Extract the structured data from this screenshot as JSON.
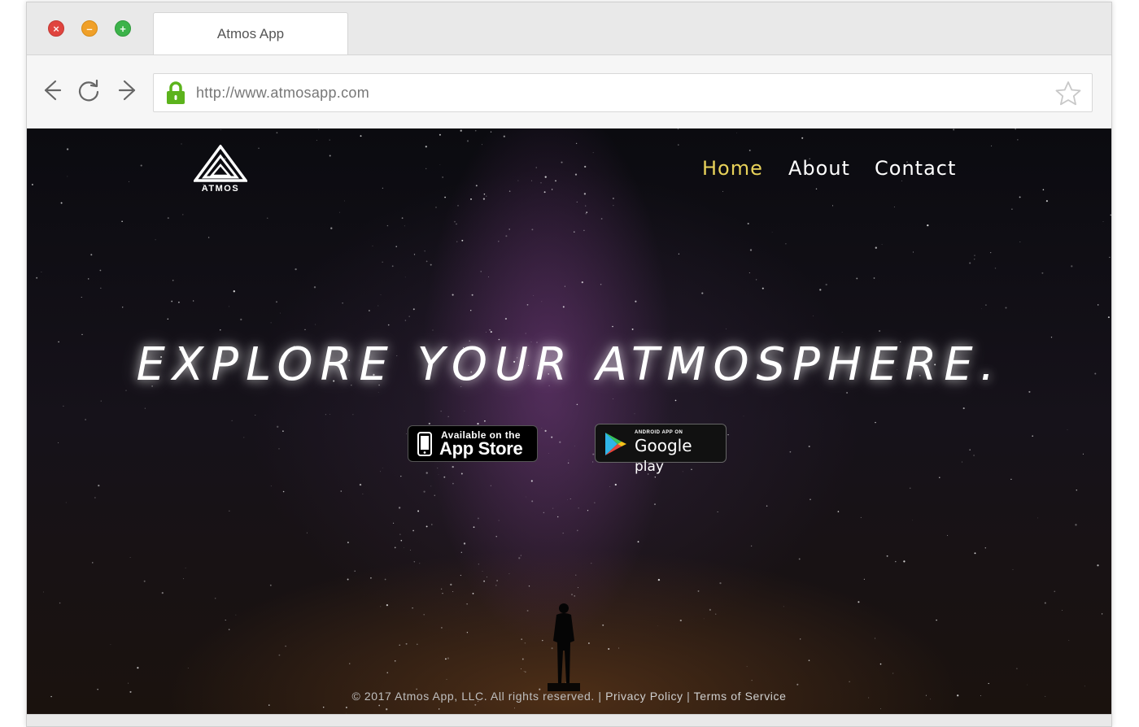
{
  "browser": {
    "tab_title": "Atmos App",
    "url": "http://www.atmosapp.com",
    "icons": {
      "close": "close-icon",
      "minimize": "minimize-icon",
      "maximize": "maximize-icon",
      "back": "back-arrow-icon",
      "reload": "reload-icon",
      "forward": "forward-arrow-icon",
      "lock": "lock-icon",
      "bookmark": "star-icon"
    },
    "lock_color": "#5cb31c"
  },
  "site": {
    "logo_text": "ATMOS",
    "nav": [
      {
        "label": "Home",
        "active": true
      },
      {
        "label": "About",
        "active": false
      },
      {
        "label": "Contact",
        "active": false
      }
    ],
    "nav_active_color": "#e8d25a",
    "headline": "EXPLORE YOUR ATMOSPHERE.",
    "app_store": {
      "line1": "Available on the",
      "line2": "App Store"
    },
    "google_play": {
      "line1": "ANDROID APP ON",
      "line2": "Google",
      "line3": "play"
    },
    "footer": {
      "copyright": "© 2017 Atmos App, LLC. All rights reserved.",
      "separator": "|",
      "privacy": "Privacy Policy",
      "terms": "Terms of Service"
    }
  }
}
